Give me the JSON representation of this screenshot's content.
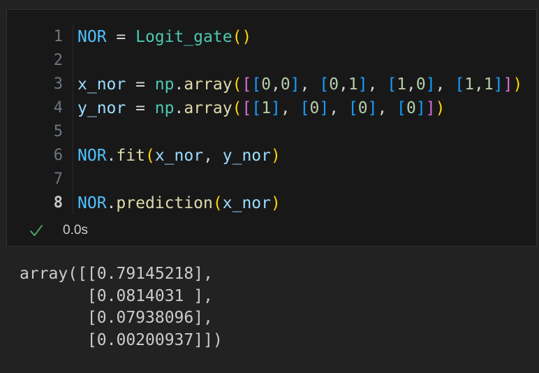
{
  "colors": {
    "const": "#4FC1FF",
    "var": "#9CDCFE",
    "class": "#4EC9B0",
    "func": "#DCDCAA",
    "num": "#B5CEA8",
    "plain": "#D4D4D4",
    "b1": "#FFD700",
    "b2": "#DA70D6",
    "b3": "#179FFF",
    "check": "#4DB56B",
    "line_number": "#6E7681",
    "line_number_active": "#C9C9C9",
    "exec_time": "#CCCCCC",
    "output_text": "#CCCCCC",
    "cell_bg": "#181819",
    "notebook_bg": "#222223",
    "cell_border": "#30303A",
    "guide_line": "#2A2A2D"
  },
  "cell": {
    "lines": [
      {
        "number": "1",
        "active": false,
        "tokens": [
          [
            "NOR",
            "const"
          ],
          [
            " = ",
            "plain"
          ],
          [
            "Logit_gate",
            "class"
          ],
          [
            "()",
            "b1"
          ]
        ]
      },
      {
        "number": "2",
        "active": false,
        "tokens": []
      },
      {
        "number": "3",
        "active": false,
        "tokens": [
          [
            "x_nor",
            "var"
          ],
          [
            " = ",
            "plain"
          ],
          [
            "np",
            "class"
          ],
          [
            ".",
            "plain"
          ],
          [
            "array",
            "func"
          ],
          [
            "(",
            "b1"
          ],
          [
            "[",
            "b2"
          ],
          [
            "[",
            "b3"
          ],
          [
            "0",
            "num"
          ],
          [
            ",",
            "plain"
          ],
          [
            "0",
            "num"
          ],
          [
            "]",
            "b3"
          ],
          [
            ", ",
            "plain"
          ],
          [
            "[",
            "b3"
          ],
          [
            "0",
            "num"
          ],
          [
            ",",
            "plain"
          ],
          [
            "1",
            "num"
          ],
          [
            "]",
            "b3"
          ],
          [
            ", ",
            "plain"
          ],
          [
            "[",
            "b3"
          ],
          [
            "1",
            "num"
          ],
          [
            ",",
            "plain"
          ],
          [
            "0",
            "num"
          ],
          [
            "]",
            "b3"
          ],
          [
            ", ",
            "plain"
          ],
          [
            "[",
            "b3"
          ],
          [
            "1",
            "num"
          ],
          [
            ",",
            "plain"
          ],
          [
            "1",
            "num"
          ],
          [
            "]",
            "b3"
          ],
          [
            "]",
            "b2"
          ],
          [
            ")",
            "b1"
          ]
        ]
      },
      {
        "number": "4",
        "active": false,
        "tokens": [
          [
            "y_nor",
            "var"
          ],
          [
            " = ",
            "plain"
          ],
          [
            "np",
            "class"
          ],
          [
            ".",
            "plain"
          ],
          [
            "array",
            "func"
          ],
          [
            "(",
            "b1"
          ],
          [
            "[",
            "b2"
          ],
          [
            "[",
            "b3"
          ],
          [
            "1",
            "num"
          ],
          [
            "]",
            "b3"
          ],
          [
            ", ",
            "plain"
          ],
          [
            "[",
            "b3"
          ],
          [
            "0",
            "num"
          ],
          [
            "]",
            "b3"
          ],
          [
            ", ",
            "plain"
          ],
          [
            "[",
            "b3"
          ],
          [
            "0",
            "num"
          ],
          [
            "]",
            "b3"
          ],
          [
            ", ",
            "plain"
          ],
          [
            "[",
            "b3"
          ],
          [
            "0",
            "num"
          ],
          [
            "]",
            "b3"
          ],
          [
            "]",
            "b2"
          ],
          [
            ")",
            "b1"
          ]
        ]
      },
      {
        "number": "5",
        "active": false,
        "tokens": []
      },
      {
        "number": "6",
        "active": false,
        "tokens": [
          [
            "NOR",
            "const"
          ],
          [
            ".",
            "plain"
          ],
          [
            "fit",
            "func"
          ],
          [
            "(",
            "b1"
          ],
          [
            "x_nor",
            "var"
          ],
          [
            ", ",
            "plain"
          ],
          [
            "y_nor",
            "var"
          ],
          [
            ")",
            "b1"
          ]
        ]
      },
      {
        "number": "7",
        "active": false,
        "tokens": []
      },
      {
        "number": "8",
        "active": true,
        "tokens": [
          [
            "NOR",
            "const"
          ],
          [
            ".",
            "plain"
          ],
          [
            "prediction",
            "func"
          ],
          [
            "(",
            "b1"
          ],
          [
            "x_nor",
            "var"
          ],
          [
            ")",
            "b1"
          ]
        ]
      }
    ],
    "status": {
      "check_icon": "success-check",
      "exec_time": "0.0s"
    }
  },
  "output": {
    "lines": [
      "array([[0.79145218],",
      "       [0.0814031 ],",
      "       [0.07938096],",
      "       [0.00200937]])"
    ]
  }
}
